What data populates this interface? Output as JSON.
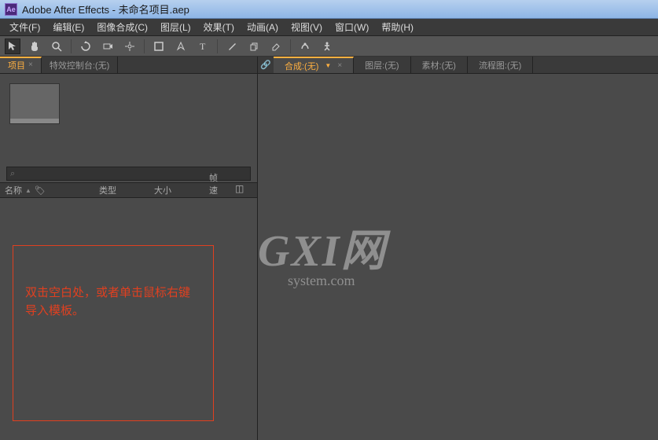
{
  "title": "Adobe After Effects - 未命名项目.aep",
  "app_icon": "Ae",
  "menu": {
    "file": "文件(F)",
    "edit": "编辑(E)",
    "composition": "图像合成(C)",
    "layer": "图层(L)",
    "effect": "效果(T)",
    "animation": "动画(A)",
    "view": "视图(V)",
    "window": "窗口(W)",
    "help": "帮助(H)"
  },
  "left": {
    "tabs": {
      "project": "项目",
      "effects_panel": "特效控制台:(无)"
    },
    "search_placeholder": "⌕",
    "columns": {
      "name": "名称",
      "type": "类型",
      "size": "大小",
      "rate": "帧速率"
    },
    "hint": "双击空白处，或者单击鼠标右键导入模板。"
  },
  "right": {
    "tabs": {
      "comp": "合成:(无)",
      "layer": "图层:(无)",
      "footage": "素材:(无)",
      "flowchart": "流程图:(无)"
    }
  },
  "watermark": {
    "big": "GXI网",
    "small": "system.com"
  }
}
